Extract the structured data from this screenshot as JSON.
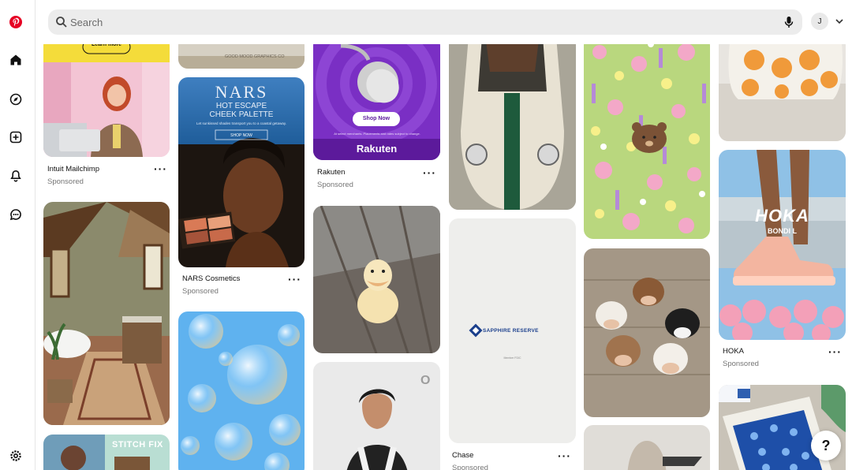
{
  "search": {
    "placeholder": "Search"
  },
  "account": {
    "initial": "J"
  },
  "pins": [
    {
      "title": "Intuit Mailchimp",
      "subtitle": "Sponsored",
      "cta": "Learn more"
    },
    {
      "title": "NARS Cosmetics",
      "subtitle": "Sponsored",
      "brand": "NARS",
      "headline": "HOT ESCAPE CHEEK PALETTE",
      "body": "Let sunkissed shades transport you to a coastal getaway.",
      "cta": "SHOP NOW"
    },
    {
      "title": "Rakuten",
      "subtitle": "Sponsored",
      "cta": "Shop Now",
      "logo": "Rakuten",
      "fineprint": "At select merchants. Placements and rates subject to change."
    },
    {
      "title": "Chase",
      "subtitle": "Sponsored",
      "brand": "SAPPHIRE RESERVE",
      "fineprint": "Member FDIC"
    },
    {
      "title": "HOKA",
      "subtitle": "Sponsored",
      "brand": "HOKA",
      "model": "BONDI L"
    },
    {
      "brand": "STITCH FIX"
    },
    {
      "brand": "GOOD MOOD GRAPHICS CO"
    }
  ],
  "help": {
    "label": "?"
  },
  "colors": {
    "brand": "#e60023",
    "search_bg": "#ececec",
    "muted": "#767676"
  }
}
